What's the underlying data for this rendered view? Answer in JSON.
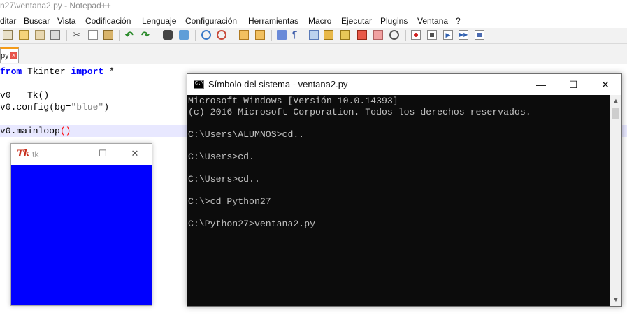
{
  "notepad": {
    "title": "n27\\ventana2.py - Notepad++",
    "menu": [
      "ditar",
      "Buscar",
      "Vista",
      "Codificación",
      "Lenguaje",
      "Configuración",
      "Herramientas",
      "Macro",
      "Ejecutar",
      "Plugins",
      "Ventana",
      "?"
    ],
    "tab": {
      "label": "py",
      "close_glyph": "×"
    },
    "code": {
      "line1_kw1": "from",
      "line1_mid": " Tkinter ",
      "line1_kw2": "import",
      "line1_end": " *",
      "line2": "v0 = Tk()",
      "line3_pre": "v0.config(bg=",
      "line3_str": "\"blue\"",
      "line3_post": ")",
      "line4_pre": "v0.mainloop",
      "line4_paren": "()"
    },
    "toolbar_icons": [
      "new-file-icon",
      "open-file-icon",
      "save-icon",
      "save-all-icon",
      "close-icon",
      "close-all-icon",
      "print-icon",
      "cut-icon",
      "copy-icon",
      "paste-icon",
      "undo-icon",
      "redo-icon",
      "find-icon",
      "replace-icon",
      "zoom-in-icon",
      "zoom-out-icon",
      "sync-v-icon",
      "sync-h-icon",
      "word-wrap-icon",
      "all-chars-icon",
      "indent-guide-icon",
      "udl-icon",
      "doc-map-icon",
      "function-list-icon",
      "folder-workspace-icon",
      "monitoring-icon",
      "record-macro-icon",
      "stop-record-icon",
      "play-macro-icon",
      "play-multiple-icon",
      "save-macro-icon"
    ]
  },
  "tk_window": {
    "logo": "Tk",
    "title": "tk",
    "controls": {
      "minimize": "—",
      "maximize": "☐",
      "close": "✕"
    },
    "canvas_color": "#0000ff"
  },
  "console": {
    "icon_text": "C:\\",
    "title": "Símbolo del sistema - ventana2.py",
    "controls": {
      "minimize": "—",
      "maximize": "☐",
      "close": "✕"
    },
    "lines": [
      "Microsoft Windows [Versión 10.0.14393]",
      "(c) 2016 Microsoft Corporation. Todos los derechos reservados.",
      "",
      "C:\\Users\\ALUMNOS>cd..",
      "",
      "C:\\Users>cd.",
      "",
      "C:\\Users>cd..",
      "",
      "C:\\>cd Python27",
      "",
      "C:\\Python27>ventana2.py"
    ],
    "scroll_up": "▲",
    "scroll_down": "▼"
  },
  "colors": {
    "tab_accent": "#f49b19",
    "keyword": "#0000ff",
    "string": "#808080",
    "console_text": "#c0c0c0",
    "console_bg": "#0c0c0c"
  }
}
